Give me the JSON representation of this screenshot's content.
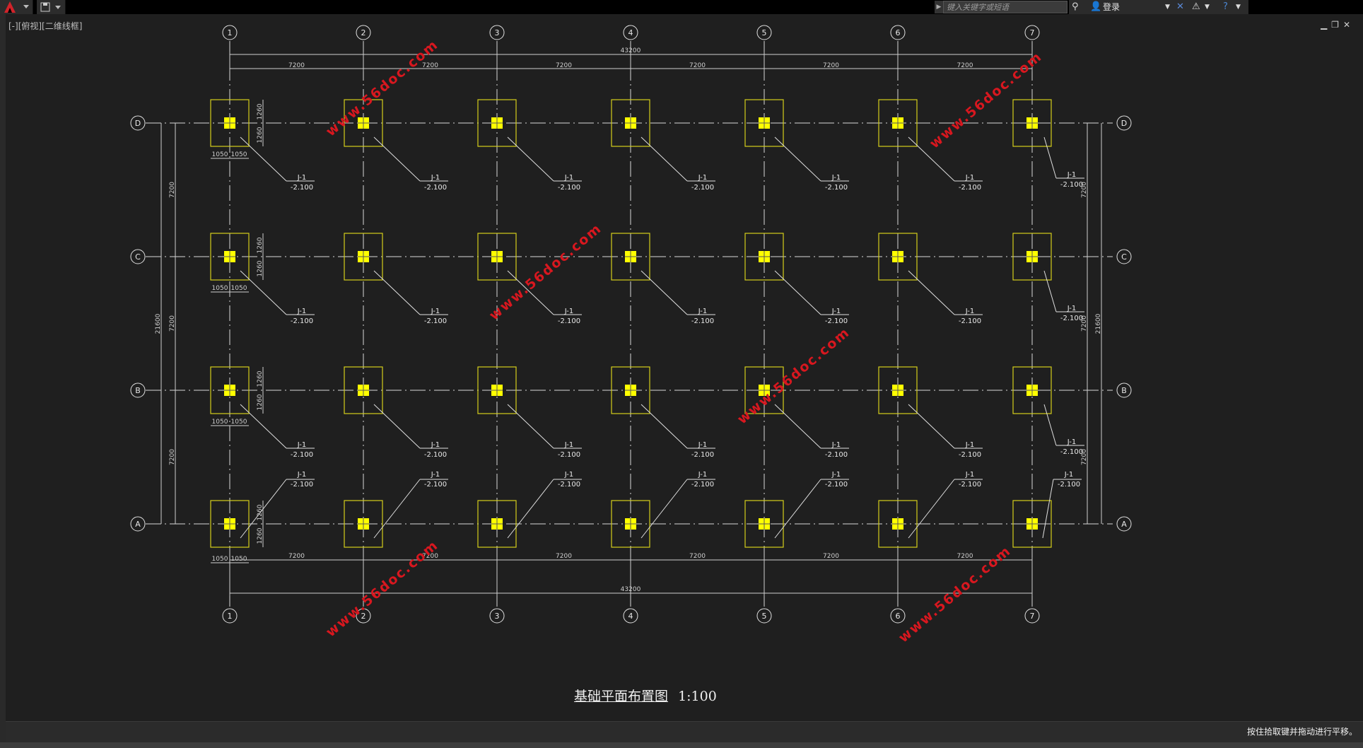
{
  "app": {
    "search_placeholder": "键入关键字或短语",
    "login_label": "登录",
    "viewport_label": "[-][俯视][二维线框]",
    "status_text": "按住拾取键并拖动进行平移。"
  },
  "drawing": {
    "title": "基础平面布置图",
    "scale": "1:100",
    "column_axes": [
      "1",
      "2",
      "3",
      "4",
      "5",
      "6",
      "7"
    ],
    "row_axes": [
      "D",
      "C",
      "B",
      "A"
    ],
    "bay_dims": [
      "7200",
      "7200",
      "7200",
      "7200",
      "7200",
      "7200"
    ],
    "total_width": "43200",
    "row_dims": [
      "7200",
      "7200",
      "7200"
    ],
    "total_depth": "21600",
    "footing_label": "J-1",
    "footing_elev": "-2.100",
    "footing_half_x": "1050",
    "footing_half_y": "1260",
    "watermarks": [
      "www.56doc.com",
      "www.56doc.com",
      "www.56doc.com",
      "www.56doc.com",
      "www.56doc.com",
      "www.56doc.com"
    ]
  }
}
